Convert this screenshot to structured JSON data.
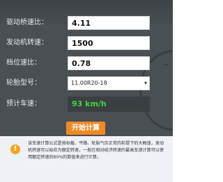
{
  "form": {
    "fields": [
      {
        "label": "驱动桥速比：",
        "value": "4.11"
      },
      {
        "label": "发动机转速：",
        "value": "1500"
      },
      {
        "label": "档位速比：",
        "value": "0.78"
      }
    ],
    "tire": {
      "label": "轮胎型号：",
      "selected": "11.00R20-18",
      "arrow_icon": "chevron-down-icon"
    },
    "result": {
      "label": "预计车速：",
      "value": "93 km/h"
    },
    "submit_label": "开始计算"
  },
  "notice": {
    "icon": "warning-icon",
    "icon_glyph": "!",
    "text": "该车速计算公式是按标载、平路、轮胎气压正常的前提下的大概值，发动机转速可以标应为额定转速，一般在相对经济转速的最高车速计算可以使用额定转速的80%的数值来进行计算。"
  },
  "colors": {
    "panel_bg": "#4a4f54",
    "button": "#f08a24",
    "result_text": "#3fd63f",
    "notice_bg": "#eef1f5",
    "warning": "#f5a623"
  }
}
